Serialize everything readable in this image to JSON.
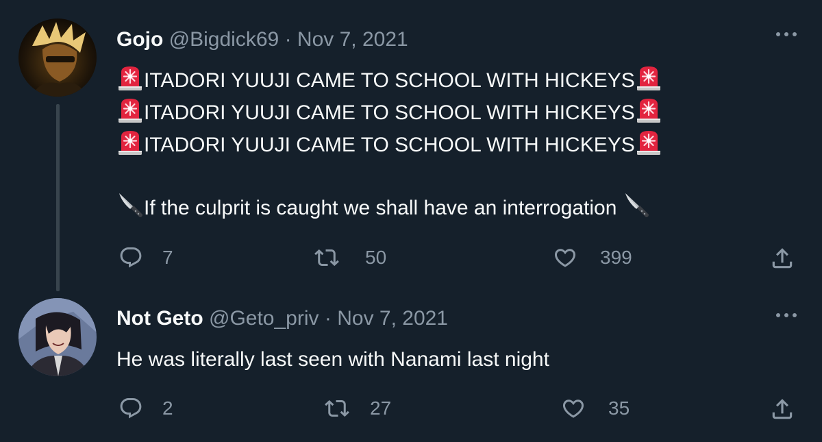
{
  "tweets": [
    {
      "name": "Gojo",
      "handle": "@Bigdick69",
      "separator": "·",
      "date": "Nov 7, 2021",
      "lines": [
        "ITADORI YUUJI CAME TO SCHOOL WITH HICKEYS",
        "ITADORI YUUJI CAME TO SCHOOL WITH HICKEYS",
        "ITADORI YUUJI CAME TO SCHOOL WITH HICKEYS"
      ],
      "line2": "If the culprit is caught we shall have an interrogation",
      "replies": "7",
      "retweets": "50",
      "likes": "399"
    },
    {
      "name": "Not Geto",
      "handle": "@Geto_priv",
      "separator": "·",
      "date": "Nov 7, 2021",
      "text": "He was literally last seen with Nanami last night",
      "replies": "2",
      "retweets": "27",
      "likes": "35"
    }
  ],
  "icons": {
    "emoji_a": "police-light-icon",
    "emoji_b": "knife-icon",
    "reply": "reply-icon",
    "retweet": "retweet-icon",
    "like": "heart-icon",
    "share": "share-icon",
    "more": "more-icon"
  },
  "colors": {
    "background": "#15202b",
    "text": "#f7f9f9",
    "secondary": "#8b98a5",
    "thread_line": "#38444d"
  }
}
